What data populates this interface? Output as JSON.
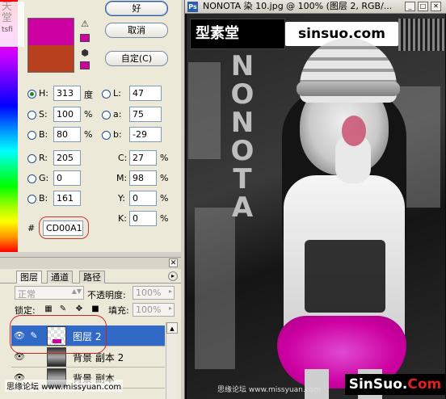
{
  "picker": {
    "watermark_top": "天",
    "watermark_mid": "堂",
    "watermark_small": "tsfi",
    "ok_label": "好",
    "cancel_label": "取消",
    "custom_label": "自定(C)",
    "hsb": {
      "h_label": "H:",
      "h_value": "313",
      "h_unit": "度",
      "s_label": "S:",
      "s_value": "100",
      "s_unit": "%",
      "b_label": "B:",
      "b_value": "80",
      "b_unit": "%"
    },
    "lab": {
      "l_label": "L:",
      "l_value": "47",
      "a_label": "a:",
      "a_value": "75",
      "b_label": "b:",
      "b_value": "-29"
    },
    "rgb": {
      "r_label": "R:",
      "r_value": "205",
      "g_label": "G:",
      "g_value": "0",
      "b_label": "B:",
      "b_value": "161"
    },
    "cmyk": {
      "c_label": "C:",
      "c_value": "27",
      "c_unit": "%",
      "m_label": "M:",
      "m_value": "98",
      "m_unit": "%",
      "y_label": "Y:",
      "y_value": "0",
      "y_unit": "%",
      "k_label": "K:",
      "k_value": "0",
      "k_unit": "%"
    },
    "hex_label": "#",
    "hex_value": "CD00A1",
    "new_color": "#CD00A1",
    "old_color": "#B8401C"
  },
  "layers": {
    "tabs": [
      "图层",
      "通道",
      "路径"
    ],
    "blend_mode": "正常",
    "opacity_label": "不透明度:",
    "opacity_value": "100%",
    "lock_label": "锁定:",
    "fill_label": "填充:",
    "fill_value": "100%",
    "rows": [
      {
        "name": "图层 2",
        "selected": true
      },
      {
        "name": "背景 副本 2",
        "selected": false
      },
      {
        "name": "背景 副本",
        "selected": false
      }
    ]
  },
  "bottom_watermark": "思缘论坛 www.missyuan.com",
  "document": {
    "title": "NONOTA 染 10.jpg @ 100% (图层 2, RGB/...",
    "logo_left": "型素堂",
    "logo_right": "sinsuo.com",
    "vertical_text": "NONOTA",
    "badge_white": "SinSuo.",
    "badge_red": "Com",
    "bottom_url": "思缘论坛 www.missyuan.com"
  }
}
